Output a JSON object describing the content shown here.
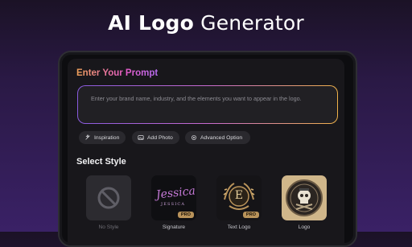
{
  "headline": {
    "bold": "AI Logo",
    "light": "Generator"
  },
  "prompt": {
    "title": "Enter Your Prompt",
    "placeholder": "Enter your brand name, industry, and the elements you want to appear in the logo."
  },
  "chips": [
    {
      "label": "Inspiration",
      "icon": "sparkle-icon"
    },
    {
      "label": "Add Photo",
      "icon": "image-icon"
    },
    {
      "label": "Advanced Option",
      "icon": "gear-icon"
    }
  ],
  "style_section": {
    "title": "Select Style",
    "items": [
      {
        "label": "No Style",
        "icon": "block-icon"
      },
      {
        "label": "Signature",
        "badge": "PRO",
        "sample": "Jessica",
        "sample_sub": "JESSICA"
      },
      {
        "label": "Text Logo",
        "badge": "PRO",
        "sample": "E"
      },
      {
        "label": "Logo"
      }
    ]
  },
  "colors": {
    "accent_start": "#f0a25a",
    "accent_mid": "#e65bc8",
    "accent_end": "#b66cf0",
    "pro_badge": "#b9935a"
  }
}
